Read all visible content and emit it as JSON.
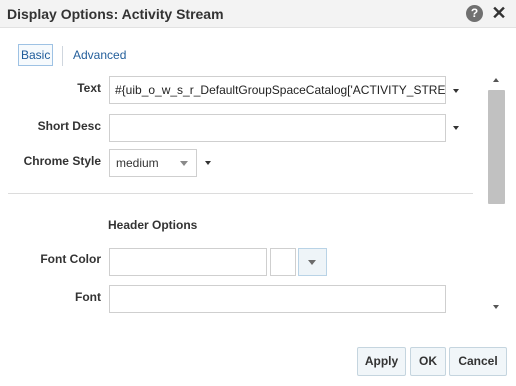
{
  "dialog": {
    "title": "Display Options: Activity Stream",
    "help_glyph": "?",
    "close_glyph": "✕"
  },
  "tabs": [
    {
      "label": "Basic",
      "selected": true
    },
    {
      "label": "Advanced",
      "selected": false
    }
  ],
  "fields": {
    "text": {
      "label": "Text",
      "value": "#{uib_o_w_s_r_DefaultGroupSpaceCatalog['ACTIVITY_STREAM']}"
    },
    "short_desc": {
      "label": "Short Desc",
      "value": ""
    },
    "chrome_style": {
      "label": "Chrome Style",
      "value": "medium"
    }
  },
  "header_options": {
    "title": "Header Options",
    "font_color": {
      "label": "Font Color",
      "value": ""
    },
    "font": {
      "label": "Font",
      "value": ""
    }
  },
  "buttons": {
    "apply": "Apply",
    "ok": "OK",
    "cancel": "Cancel"
  },
  "colors": {
    "link": "#245f9b",
    "button_bg": "#f1f6f9",
    "title_bar": "#f3f3f3"
  }
}
